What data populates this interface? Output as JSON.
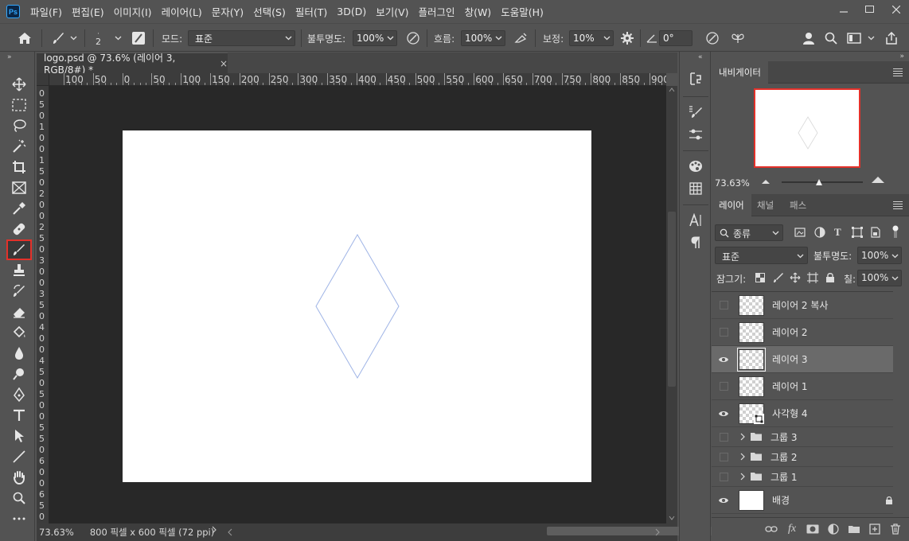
{
  "app": {
    "logo": "Ps"
  },
  "menu": [
    "파일(F)",
    "편집(E)",
    "이미지(I)",
    "레이어(L)",
    "문자(Y)",
    "선택(S)",
    "필터(T)",
    "3D(D)",
    "보기(V)",
    "플러그인",
    "창(W)",
    "도움말(H)"
  ],
  "options": {
    "brush_size": "2",
    "mode_label": "모드:",
    "mode_value": "표준",
    "opacity_label": "불투명도:",
    "opacity_value": "100%",
    "flow_label": "흐름:",
    "flow_value": "100%",
    "smoothing_label": "보정:",
    "smoothing_value": "10%",
    "angle_value": "0°"
  },
  "document": {
    "tab_title": "logo.psd @ 73.6% (레이어 3, RGB/8#) *",
    "close_glyph": "×",
    "ruler_h_labels": [
      "100",
      "50",
      "0",
      "50",
      "100",
      "150",
      "200",
      "250",
      "300",
      "350",
      "400",
      "450",
      "500",
      "550",
      "600",
      "650",
      "700",
      "750",
      "800",
      "850",
      "900"
    ],
    "ruler_v_labels": [
      "0",
      "5",
      "0",
      "1",
      "0",
      "0",
      "1",
      "5",
      "0",
      "2",
      "0",
      "0",
      "2",
      "5",
      "0",
      "3",
      "0",
      "0",
      "3",
      "5",
      "0",
      "4",
      "0",
      "0",
      "4",
      "5",
      "0",
      "5",
      "0",
      "0",
      "5",
      "5",
      "0",
      "6",
      "0",
      "0",
      "6",
      "5",
      "0"
    ],
    "zoom": "73.63%",
    "size_info": "800 픽셀 x 600 픽셀 (72 ppi)",
    "diamond_color": "#9fb4e6"
  },
  "navigator": {
    "tab": "내비게이터",
    "zoom": "73.63%"
  },
  "layers_panel": {
    "tabs": [
      "레이어",
      "채널",
      "패스"
    ],
    "filter_kind": "종류",
    "blend_mode": "표준",
    "opacity_label": "불투명도:",
    "opacity_value": "100%",
    "lock_label": "잠그기:",
    "fill_label": "칠:",
    "fill_value": "100%",
    "layers": [
      {
        "name": "레이어 2 복사",
        "visible": false,
        "type": "pixel"
      },
      {
        "name": "레이어 2",
        "visible": false,
        "type": "pixel"
      },
      {
        "name": "레이어 3",
        "visible": true,
        "type": "pixel",
        "selected": true
      },
      {
        "name": "레이어 1",
        "visible": false,
        "type": "pixel"
      },
      {
        "name": "사각형 4",
        "visible": true,
        "type": "shape"
      },
      {
        "name": "그룹 3",
        "visible": false,
        "type": "group"
      },
      {
        "name": "그룹 2",
        "visible": false,
        "type": "group"
      },
      {
        "name": "그룹 1",
        "visible": false,
        "type": "group"
      },
      {
        "name": "배경",
        "visible": true,
        "type": "background"
      }
    ],
    "bottom_fx": "fx"
  },
  "colors": {
    "active_tool_border": "#e3312a",
    "accent": "#31a8ff"
  }
}
